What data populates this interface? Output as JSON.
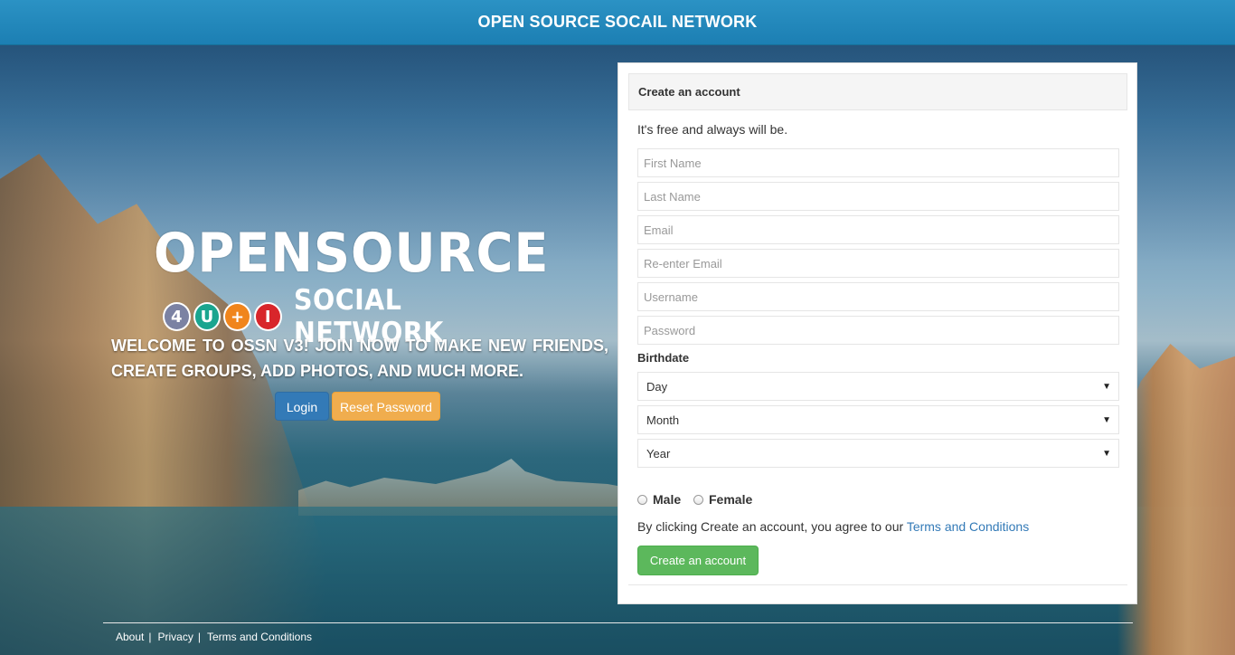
{
  "header": {
    "title": "OPEN SOURCE SOCAIL NETWORK"
  },
  "logo": {
    "main": "OPENSOURCE",
    "circles": [
      "4",
      "U",
      "+",
      "I"
    ],
    "sub": "SOCIAL NETWORK"
  },
  "welcome": {
    "text": "WELCOME TO OSSN V3! JOIN NOW TO MAKE NEW FRIENDS, CREATE GROUPS, ADD PHOTOS, AND MUCH MORE.",
    "login_label": "Login",
    "reset_label": "Reset Password"
  },
  "signup": {
    "heading": "Create an account",
    "subtitle": "It's free and always will be.",
    "fields": {
      "first_name": "First Name",
      "last_name": "Last Name",
      "email": "Email",
      "reenter_email": "Re-enter Email",
      "username": "Username",
      "password": "Password"
    },
    "birthdate_label": "Birthdate",
    "day": "Day",
    "month": "Month",
    "year": "Year",
    "male": "Male",
    "female": "Female",
    "terms_prefix": "By clicking Create an account, you agree to our ",
    "terms_link": "Terms and Conditions",
    "submit": "Create an account"
  },
  "footer": {
    "about": "About",
    "privacy": "Privacy",
    "terms": "Terms and Conditions",
    "separator": "|"
  },
  "colors": {
    "topbar": "#1c7fb3",
    "login": "#337ab7",
    "reset": "#f0ad4e",
    "create": "#5cb85c",
    "link": "#337ab7"
  }
}
